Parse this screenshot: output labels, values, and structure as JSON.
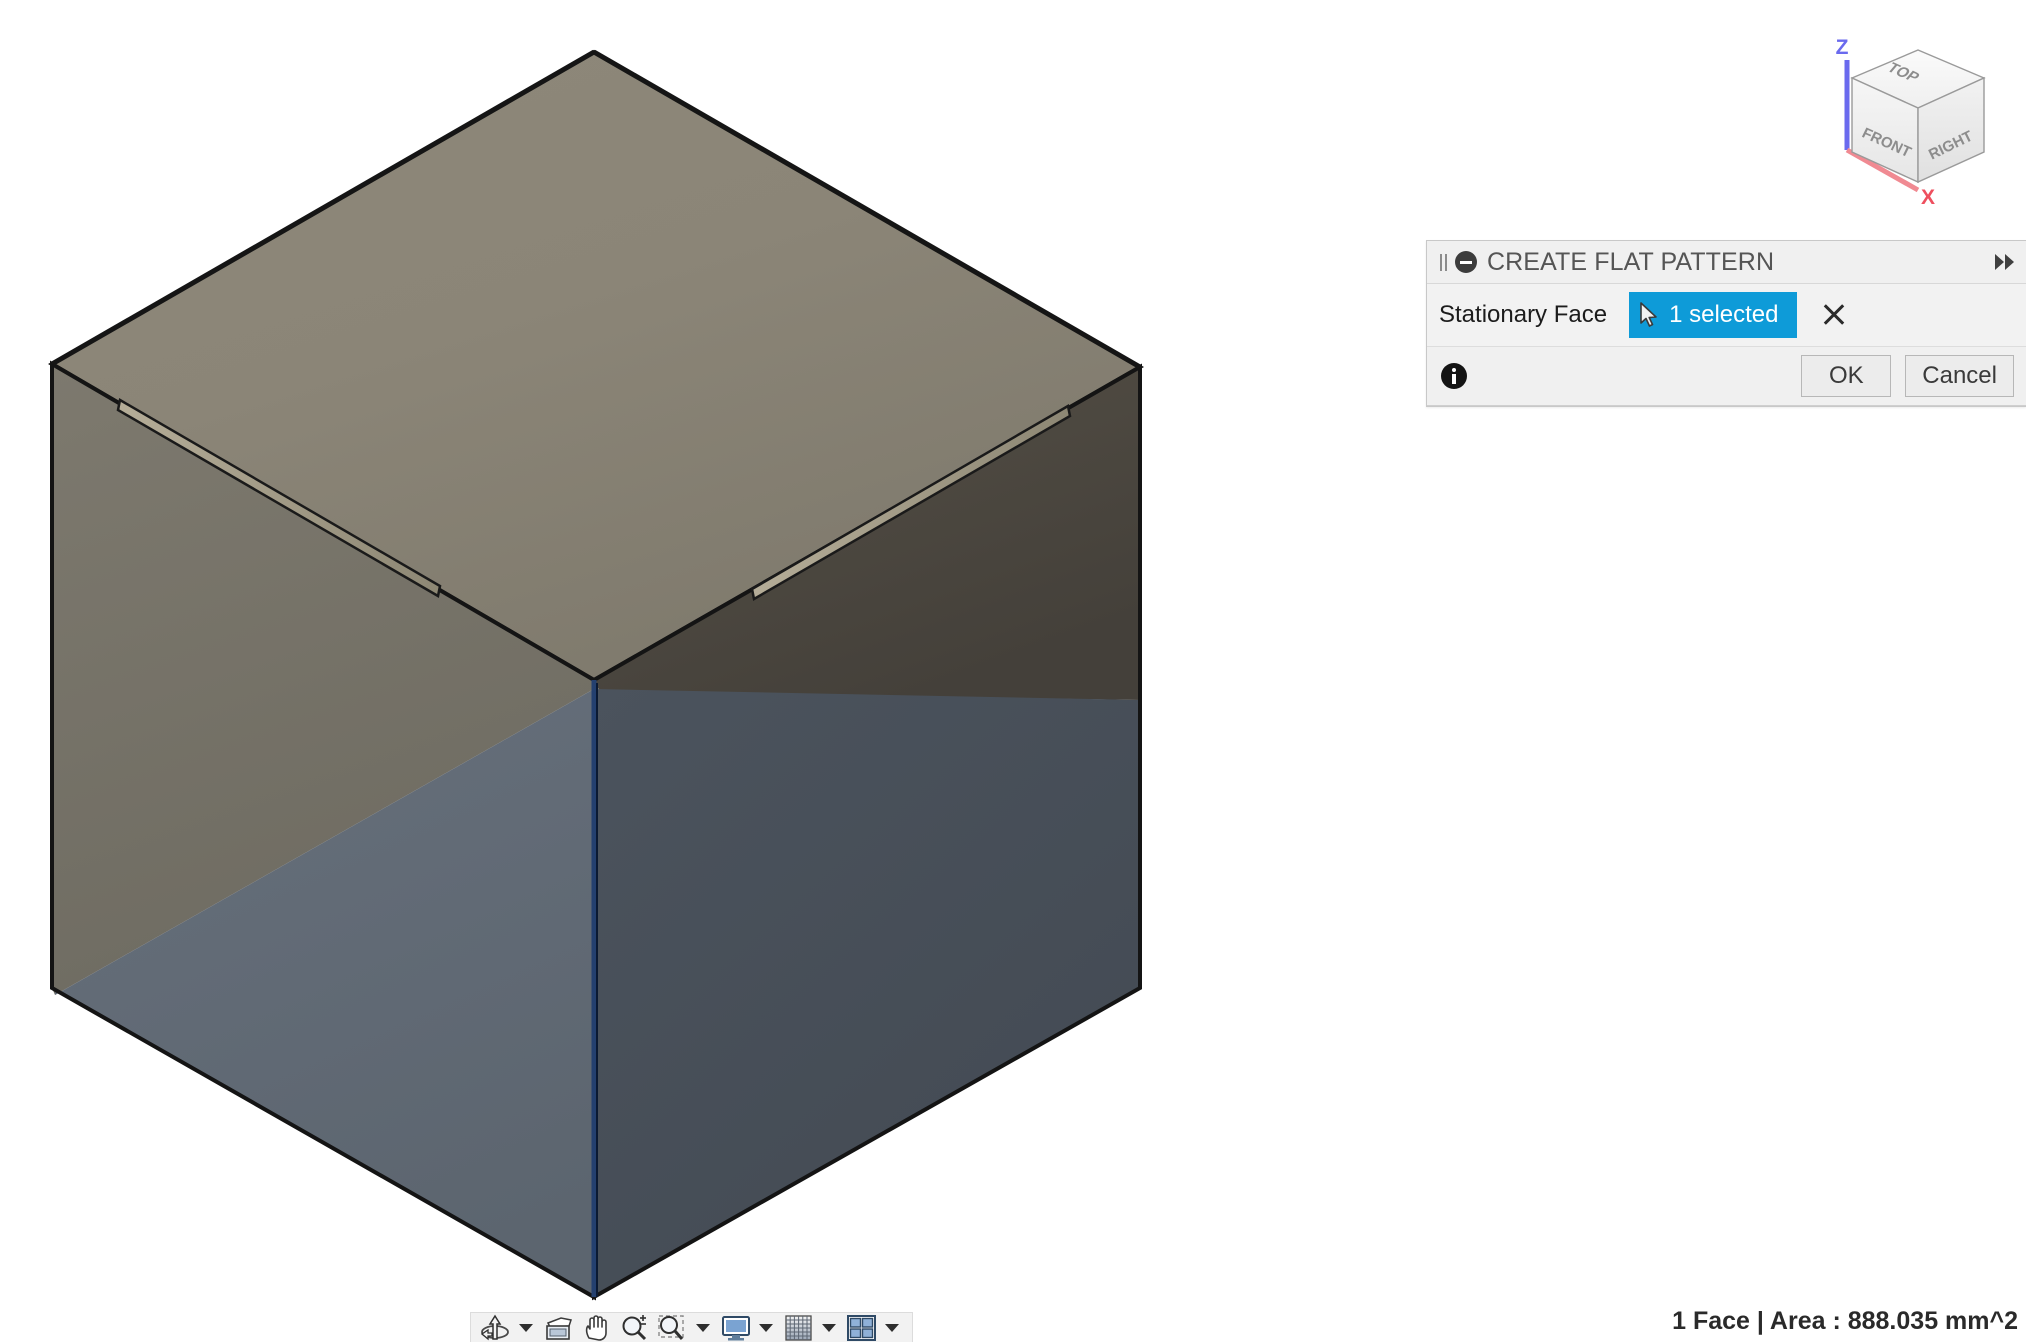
{
  "app": {
    "background_color": "#ffffff"
  },
  "viewcube": {
    "faces": {
      "top": "TOP",
      "front": "FRONT",
      "right": "RIGHT"
    },
    "axes": [
      {
        "name": "z-axis",
        "label": "Z",
        "color": "#6666ee"
      },
      {
        "name": "x-axis",
        "label": "X",
        "color": "#ee5566"
      }
    ]
  },
  "dialog": {
    "title": "CREATE FLAT PATTERN",
    "grip_icon": "drag-grip-icon",
    "collapse_icon": "collapse-circle-icon",
    "expand_icon": "fast-forward-icon",
    "field": {
      "label": "Stationary Face",
      "selection_value": "1 selected",
      "selection_color": "#0e9bd8",
      "cursor_icon": "mouse-pointer-icon",
      "clear_icon": "close-x-icon"
    },
    "footer": {
      "info_icon": "info-circle-icon",
      "ok_label": "OK",
      "cancel_label": "Cancel"
    }
  },
  "toolbar": {
    "items": [
      {
        "name": "orbit-tool",
        "icon": "orbit-icon",
        "has_caret": true
      },
      {
        "name": "look-at-tool",
        "icon": "look-at-icon",
        "has_caret": false
      },
      {
        "name": "pan-tool",
        "icon": "hand-pan-icon",
        "has_caret": false
      },
      {
        "name": "zoom-tool",
        "icon": "zoom-magnifier-icon",
        "has_caret": false
      },
      {
        "name": "zoom-window-tool",
        "icon": "zoom-window-icon",
        "has_caret": true
      },
      {
        "name": "display-style-tool",
        "icon": "monitor-display-icon",
        "has_caret": true
      },
      {
        "name": "grid-snap-tool",
        "icon": "grid-icon",
        "has_caret": true
      },
      {
        "name": "viewport-layout-tool",
        "icon": "multi-viewport-icon",
        "has_caret": true
      }
    ]
  },
  "status": {
    "text": "1 Face | Area : 888.035 mm^2",
    "selection_count": "1 Face",
    "area_label": "Area",
    "area_value": "888.035",
    "area_units": "mm^2"
  },
  "model": {
    "name": "sheet-metal-box",
    "top_face_color": "#8a8476",
    "left_face_top_color": "#79756a",
    "left_face_bottom_color": "#5c6672",
    "right_face_top_color": "#4c4840",
    "right_face_bottom_color": "#4a525c",
    "edge_color": "#111111",
    "highlight_edge_color": "#1e3a6e"
  }
}
